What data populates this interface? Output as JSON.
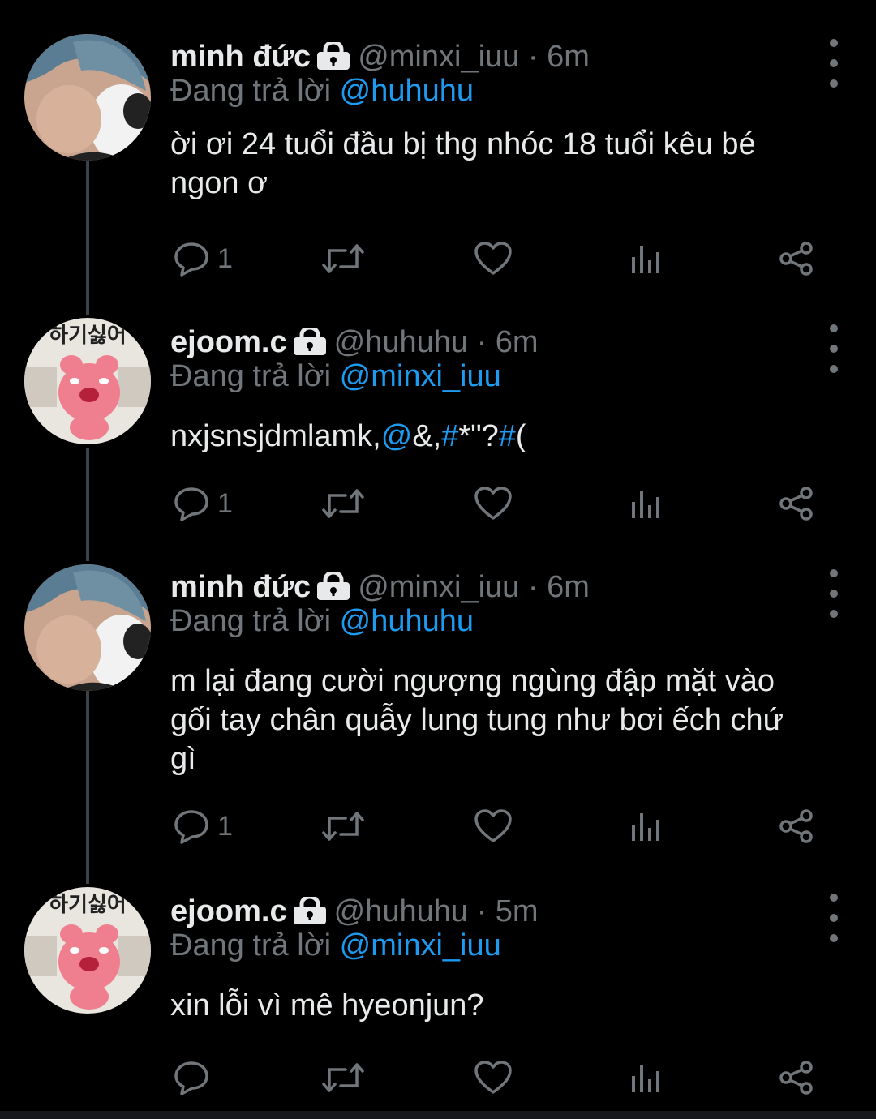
{
  "thread": {
    "tweets": [
      {
        "name": "minh đức",
        "handle": "@minxi_iuu",
        "time": "· 6m",
        "replying_prefix": "Đang trả lời",
        "replying_to": "@huhuhu",
        "text_lines": [
          "ời ơi 24 tuổi đầu bị thg nhóc 18 tuổi kêu bé",
          "ngon ơ"
        ],
        "reply_count": "1"
      },
      {
        "name": "ejoom.c",
        "handle": "@huhuhu",
        "time": "· 6m",
        "replying_prefix": "Đang trả lời",
        "replying_to": "@minxi_iuu",
        "text_parts": [
          "nxjsnsjdmlamk,",
          "@",
          "&,",
          "#",
          "*\"?",
          "#",
          "("
        ],
        "reply_count": "1",
        "avatar_label": "하기싫어"
      },
      {
        "name": "minh đức",
        "handle": "@minxi_iuu",
        "time": "· 6m",
        "replying_prefix": "Đang trả lời",
        "replying_to": "@huhuhu",
        "text_lines": [
          "m lại đang cười ngượng ngùng đập mặt vào",
          "gối tay chân quẫy lung tung như bơi ếch chứ",
          "gì"
        ],
        "reply_count": "1"
      },
      {
        "name": "ejoom.c",
        "handle": "@huhuhu",
        "time": "· 5m",
        "replying_prefix": "Đang trả lời",
        "replying_to": "@minxi_iuu",
        "text_lines": [
          "xin lỗi vì mê hyeonjun?"
        ],
        "reply_count": "",
        "avatar_label": "하기싫어"
      }
    ]
  },
  "icons": {
    "reply": "speech-bubble-icon",
    "retweet": "retweet-icon",
    "like": "heart-icon",
    "analytics": "bar-chart-icon",
    "share": "share-icon",
    "lock": "lock-icon",
    "more": "vertical-ellipsis-icon"
  },
  "colors": {
    "background": "#000000",
    "text": "#e7e9ea",
    "muted": "#71767b",
    "link": "#1d9bf0",
    "thread_line": "#3d4248"
  }
}
